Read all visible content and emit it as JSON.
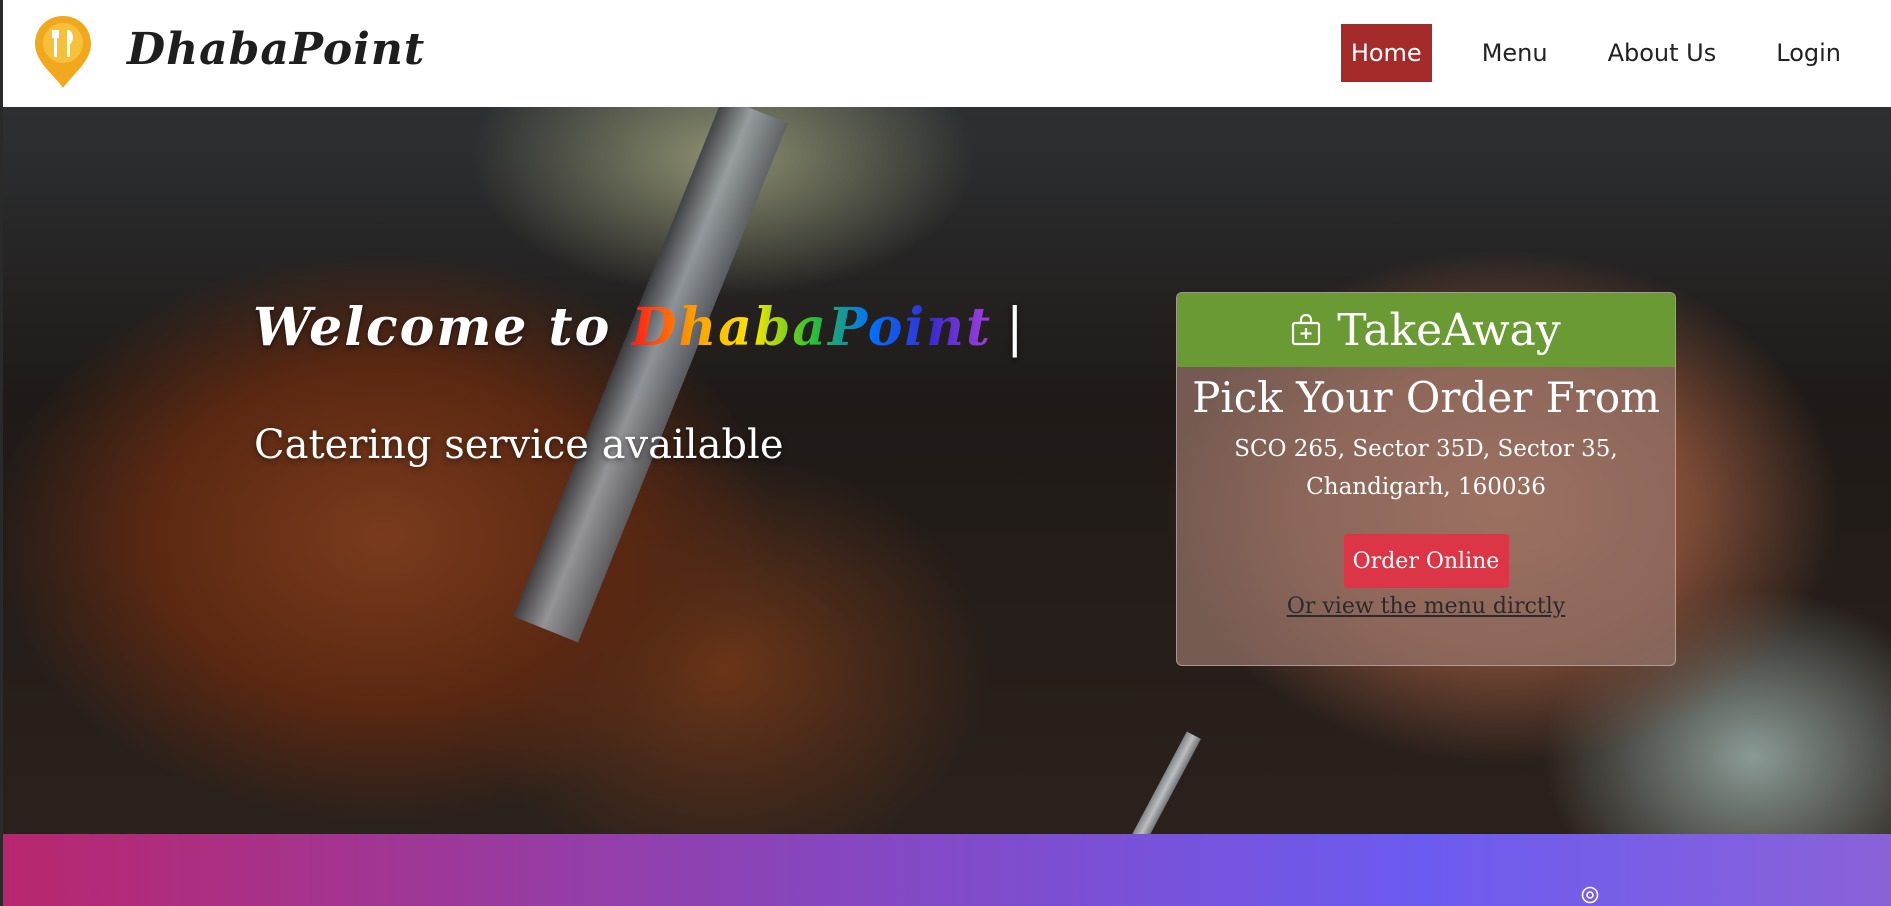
{
  "nav": {
    "brand": "DhabaPoint",
    "links": [
      "Home",
      "Menu",
      "About Us",
      "Login"
    ],
    "active": "Home",
    "active_color": "#a52a2a"
  },
  "hero": {
    "welcome_prefix": "Welcome to ",
    "welcome_brand": "DhabaPoint",
    "cursor": "|",
    "subtitle": "Catering service available"
  },
  "card": {
    "icon": "shopping-bag-plus-icon",
    "title": "TakeAway",
    "heading": "Pick Your Order From",
    "address_line1": "SCO 265, Sector 35D, Sector 35,",
    "address_line2": "Chandigarh, 160036",
    "order_button": "Order Online",
    "menu_link": "Or view the menu dirctly",
    "header_color": "#6a9a34",
    "button_color": "#dc3545"
  },
  "footer_strip": {
    "icon": "location-icon"
  }
}
